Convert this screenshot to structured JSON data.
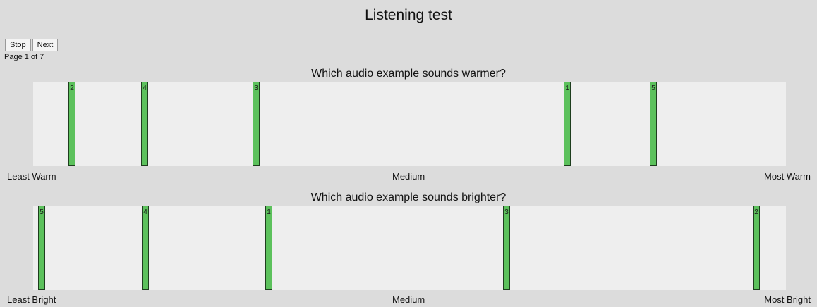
{
  "title": "Listening test",
  "controls": {
    "stop_label": "Stop",
    "next_label": "Next"
  },
  "page_info": "Page 1 of 7",
  "questions": [
    {
      "text": "Which audio example sounds warmer?",
      "scale": {
        "left": "Least Warm",
        "middle": "Medium",
        "right": "Most Warm"
      },
      "markers": [
        {
          "label": "2",
          "position": 0.047
        },
        {
          "label": "4",
          "position": 0.145
        },
        {
          "label": "3",
          "position": 0.294
        },
        {
          "label": "1",
          "position": 0.711
        },
        {
          "label": "5",
          "position": 0.827
        }
      ]
    },
    {
      "text": "Which audio example sounds brighter?",
      "scale": {
        "left": "Least Bright",
        "middle": "Medium",
        "right": "Most Bright"
      },
      "markers": [
        {
          "label": "5",
          "position": 0.007
        },
        {
          "label": "4",
          "position": 0.146
        },
        {
          "label": "1",
          "position": 0.311
        },
        {
          "label": "3",
          "position": 0.63
        },
        {
          "label": "2",
          "position": 0.965
        }
      ]
    }
  ]
}
